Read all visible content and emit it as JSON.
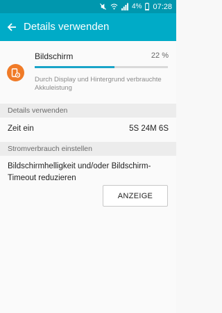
{
  "status_bar": {
    "battery_percent": "4%",
    "time": "07:28",
    "icons": [
      "mute-icon",
      "wifi-icon",
      "signal-icon",
      "battery-icon"
    ]
  },
  "app_bar": {
    "title": "Details verwenden",
    "icon": "back-arrow-icon"
  },
  "usage_item": {
    "icon": "screen-settings-icon",
    "name": "Bildschirm",
    "percent": "22 %",
    "level": 0.6,
    "description": "Durch Display und Hintergrund verbrauchte Akkuleistung"
  },
  "details_section": {
    "header": "Details verwenden",
    "rows": [
      {
        "label": "Zeit ein",
        "value": "5S 24M 6S"
      }
    ]
  },
  "power_section": {
    "header": "Stromverbrauch einstellen",
    "tip": "Bildschirmhelligkeit und/oder Bildschirm-Timeout reduzieren",
    "button_label": "ANZEIGE"
  },
  "colors": {
    "status_bar": "#0097ae",
    "app_bar": "#00abc7",
    "accent": "#1aa4c8",
    "app_icon": "#f07b28"
  }
}
